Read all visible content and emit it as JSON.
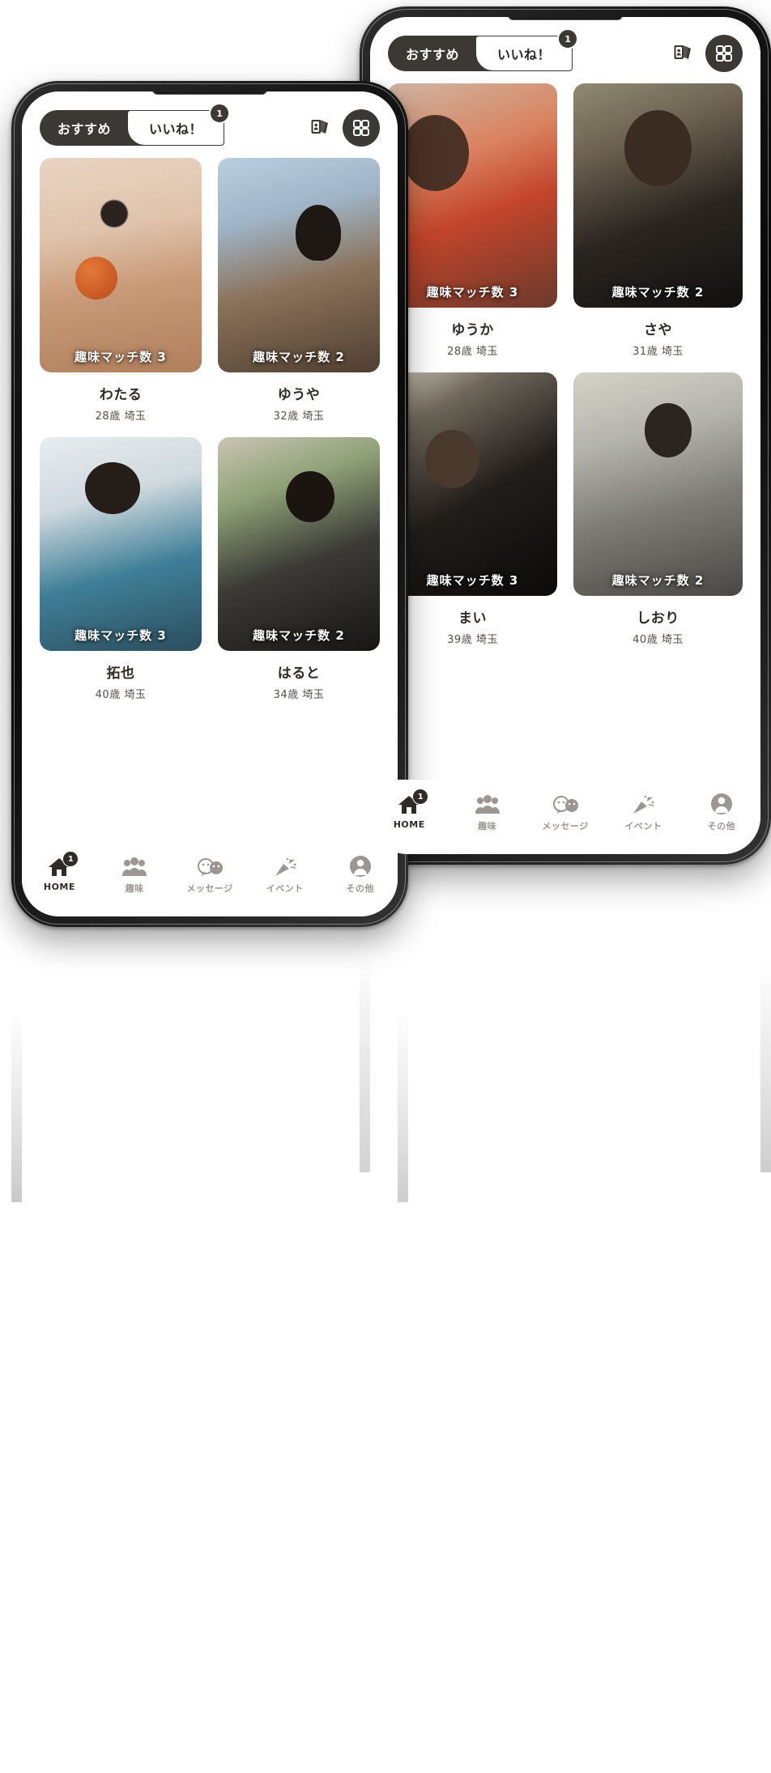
{
  "app": {
    "header": {
      "tab_recommend": "おすすめ",
      "tab_like": "いいね！",
      "like_badge": "1",
      "cards_icon": "card-stack-icon",
      "grid_icon": "grid-view-icon"
    },
    "card_match_prefix": "趣味マッチ数",
    "tabbar": [
      {
        "label": "HOME",
        "icon": "home-icon",
        "badge": "1",
        "active": true
      },
      {
        "label": "趣味",
        "icon": "people-icon",
        "badge": "",
        "active": false
      },
      {
        "label": "メッセージ",
        "icon": "chat-bubbles-icon",
        "badge": "",
        "active": false
      },
      {
        "label": "イベント",
        "icon": "party-popper-icon",
        "badge": "",
        "active": false
      },
      {
        "label": "その他",
        "icon": "person-circle-icon",
        "badge": "",
        "active": false
      }
    ]
  },
  "phone_front": {
    "cards": [
      {
        "name": "わたる",
        "meta": "28歳 埼玉",
        "match": "趣味マッチ数 3",
        "photo": "man-with-basketball-in-gym"
      },
      {
        "name": "ゆうや",
        "meta": "32歳 埼玉",
        "match": "趣味マッチ数 2",
        "photo": "man-reading-book-camping-chair"
      },
      {
        "name": "拓也",
        "meta": "40歳 埼玉",
        "match": "趣味マッチ数 3",
        "photo": "man-with-glasses-teal-shirt"
      },
      {
        "name": "はると",
        "meta": "34歳 埼玉",
        "match": "趣味マッチ数 2",
        "photo": "man-driving-car"
      }
    ]
  },
  "phone_back": {
    "cards": [
      {
        "name": "ゆうか",
        "meta": "28歳 埼玉",
        "match": "趣味マッチ数 3",
        "photo": "woman-with-phone-orange-jacket"
      },
      {
        "name": "さや",
        "meta": "31歳 埼玉",
        "match": "趣味マッチ数 2",
        "photo": "woman-smiling-black-top"
      },
      {
        "name": "まい",
        "meta": "39歳 埼玉",
        "match": "趣味マッチ数 3",
        "photo": "woman-with-cup-by-window"
      },
      {
        "name": "しおり",
        "meta": "40歳 埼玉",
        "match": "趣味マッチ数 2",
        "photo": "woman-barista-pouring-coffee"
      }
    ]
  },
  "colors": {
    "accent_dark": "#3c3833",
    "text_primary": "#2f2c28",
    "text_muted": "#9b9691",
    "surface": "#ffffff",
    "bezel": "#0a0a0a"
  }
}
